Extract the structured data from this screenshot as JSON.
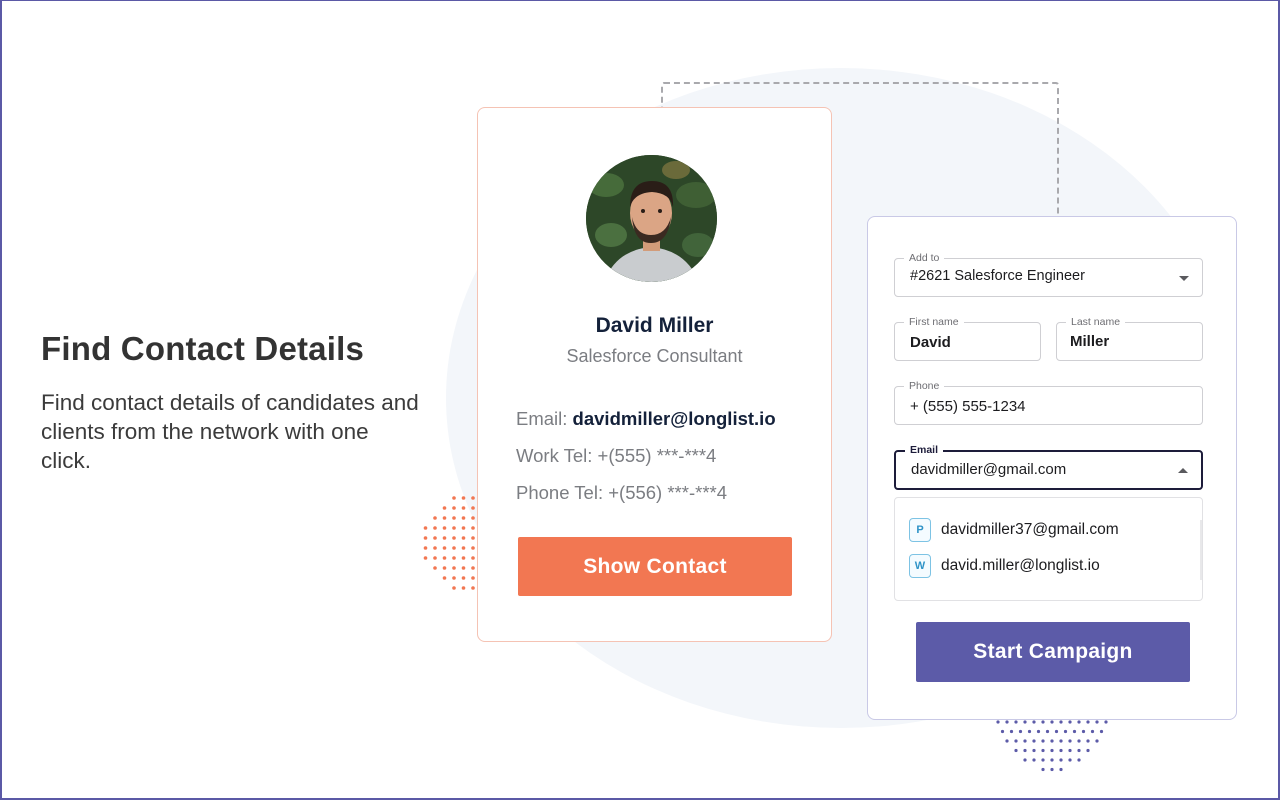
{
  "hero": {
    "title": "Find Contact Details",
    "description": "Find contact details of candidates and clients from the network with one click."
  },
  "profile_card": {
    "avatar_icon": "person-photo",
    "name": "David Miller",
    "role": "Salesforce Consultant",
    "email_label": "Email:",
    "email_value": "davidmiller@longlist.io",
    "work_tel": "Work Tel: +(555) ***-***4",
    "phone_tel": "Phone Tel: +(556) ***-***4",
    "show_contact_label": "Show Contact"
  },
  "form": {
    "add_to": {
      "label": "Add to",
      "value": "#2621 Salesforce Engineer"
    },
    "first_name": {
      "label": "First name",
      "value": "David"
    },
    "last_name": {
      "label": "Last name",
      "value": "Miller"
    },
    "phone": {
      "label": "Phone",
      "value": "+ (555) 555-1234"
    },
    "email": {
      "label": "Email",
      "value": "davidmiller@gmail.com"
    },
    "email_options": [
      {
        "tag": "P",
        "value": "davidmiller37@gmail.com"
      },
      {
        "tag": "W",
        "value": "david.miller@longlist.io"
      }
    ],
    "start_campaign_label": "Start Campaign"
  },
  "colors": {
    "accent_orange": "#f27752",
    "accent_purple": "#5c5ba8",
    "text_dark": "#14213a"
  }
}
